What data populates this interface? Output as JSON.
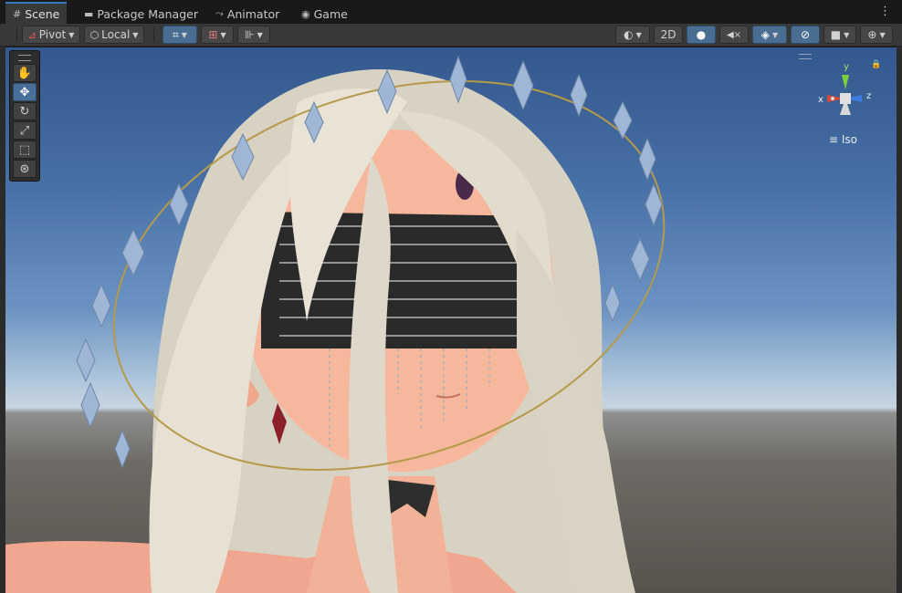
{
  "tabs": [
    {
      "label": "Scene",
      "icon": "grid-icon",
      "active": true
    },
    {
      "label": "Package Manager",
      "icon": "package-icon",
      "active": false
    },
    {
      "label": "Animator",
      "icon": "animator-icon",
      "active": false
    },
    {
      "label": "Game",
      "icon": "gamepad-icon",
      "active": false
    }
  ],
  "toolbar": {
    "pivot_label": "Pivot",
    "local_label": "Local",
    "mode_2d_label": "2D"
  },
  "tools": [
    "hand-tool",
    "move-tool",
    "rotate-tool",
    "scale-tool",
    "rect-tool",
    "transform-tool"
  ],
  "active_tool": "move-tool",
  "orientation_gizmo": {
    "x_label": "x",
    "y_label": "y",
    "z_label": "z",
    "projection_label": "Iso"
  },
  "colors": {
    "accent": "#3a79bb",
    "x_axis": "#d24a3a",
    "y_axis": "#7bd13a",
    "z_axis": "#3d7be0",
    "sky_top": "#33588d",
    "horizon": "#c9d5df",
    "ground": "#56524c"
  }
}
